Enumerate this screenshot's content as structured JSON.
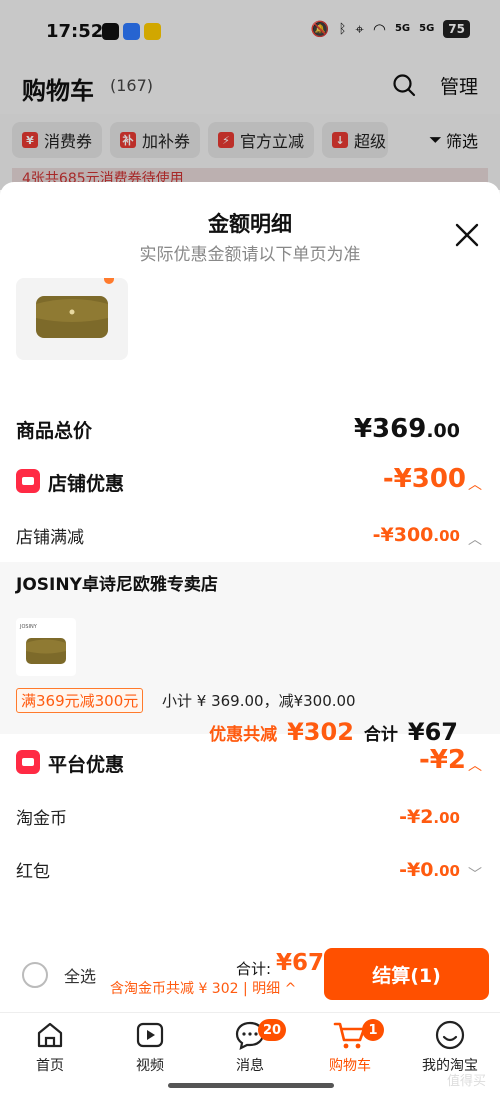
{
  "status_bar": {
    "time": "17:52",
    "battery": "75",
    "signal1": "5G",
    "signal2": "5G"
  },
  "header": {
    "title": "购物车",
    "count": "(167)",
    "manage_label": "管理"
  },
  "filters": [
    {
      "label": "消费券"
    },
    {
      "label": "加补券"
    },
    {
      "label": "官方立减"
    },
    {
      "label": "超级"
    }
  ],
  "filter_button_label": "筛选",
  "strip_text": "4张共685元消费券待使用",
  "sheet": {
    "title": "金额明细",
    "subtitle": "实际优惠金额请以下单页为准",
    "total_label": "商品总价",
    "total_value_main": "¥369",
    "total_value_dec": ".00",
    "shop_section": {
      "label": "店铺优惠",
      "value": "-¥300"
    },
    "shop_sub": {
      "label": "店铺满减",
      "value_main": "-¥300",
      "value_dec": ".00"
    },
    "store": {
      "name": "JOSINY卓诗尼欧雅专卖店",
      "thumb_brand": "JOSINY",
      "promo_tag": "满369元减300元",
      "subtotal": "小计 ¥ 369.00，减¥300.00"
    },
    "platform_section": {
      "label": "平台优惠",
      "value": "-¥2"
    },
    "coin": {
      "label": "淘金币",
      "value_main": "-¥2",
      "value_dec": ".00"
    },
    "redpacket": {
      "label": "红包",
      "value_main": "-¥0",
      "value_dec": ".00"
    },
    "totals": {
      "discount_label": "优惠共减",
      "discount_value": "¥302",
      "sum_label": "合计",
      "sum_value": "¥67"
    }
  },
  "checkout": {
    "select_all": "全选",
    "total_label": "合计:",
    "total_value": "¥67",
    "note": "含淘金币共减 ¥ 302 | 明细 ^",
    "button_label": "结算(1)"
  },
  "tabs": [
    {
      "label": "首页",
      "icon": "home-icon"
    },
    {
      "label": "视频",
      "icon": "video-icon"
    },
    {
      "label": "消息",
      "icon": "message-icon",
      "badge": "20"
    },
    {
      "label": "购物车",
      "icon": "cart-icon",
      "badge": "1",
      "active": true
    },
    {
      "label": "我的淘宝",
      "icon": "profile-icon"
    }
  ],
  "watermark": "值得买",
  "colors": {
    "accent": "#ff5000",
    "discount": "#ff5b10",
    "icon_red": "#ff2a44"
  }
}
